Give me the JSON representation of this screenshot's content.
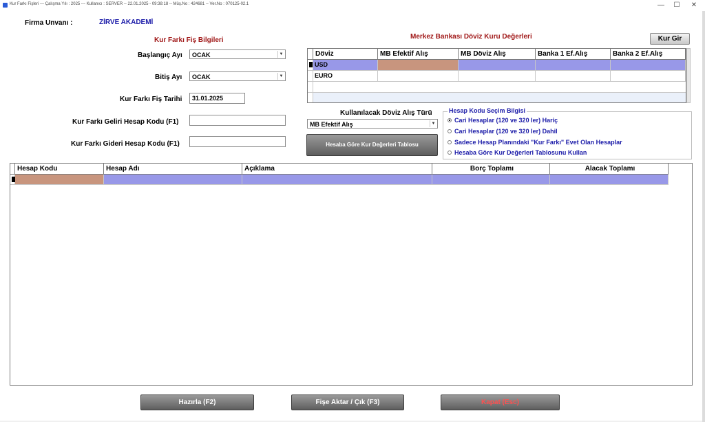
{
  "window": {
    "title": "Kur Farkı Fişleri  ---  Çalışma Yılı : 2025  ---  Kullanıcı : SERVER -- 22.01.2025 - 09:38:18  --  Müş.No : 424681 -- Ver.No : 070125-02.1",
    "minimize": "—",
    "maximize": "☐",
    "close": "✕"
  },
  "firma": {
    "label": "Firma Unvanı :",
    "value": "ZİRVE AKADEMİ"
  },
  "fis": {
    "section_title": "Kur Farkı Fiş Bilgileri",
    "baslangic_label": "Başlangıç Ayı",
    "baslangic_value": "OCAK",
    "bitis_label": "Bitiş Ayı",
    "bitis_value": "OCAK",
    "tarih_label": "Kur Farkı Fiş Tarihi",
    "tarih_value": "31.01.2025",
    "geliri_label": "Kur Farkı Geliri Hesap Kodu (F1)",
    "geliri_value": "",
    "gideri_label": "Kur Farkı Gideri Hesap Kodu (F1)",
    "gideri_value": ""
  },
  "doviz": {
    "section_title": "Merkez Bankası Döviz Kuru Değerleri",
    "kur_gir": "Kur Gir",
    "columns": [
      "Döviz",
      "MB Efektif Alış",
      "MB Döviz Alış",
      "Banka 1 Ef.Alış",
      "Banka 2 Ef.Alış"
    ],
    "rows": [
      [
        "USD",
        "",
        "",
        "",
        ""
      ],
      [
        "EURO",
        "",
        "",
        "",
        ""
      ]
    ],
    "alis_turu_label": "Kullanılacak Döviz Alış Türü",
    "alis_turu_value": "MB Efektif Alış",
    "tablo_button": "Hesaba Göre Kur Değerleri Tablosu"
  },
  "hesap_kodu": {
    "title": "Hesap Kodu Seçim Bilgisi",
    "options": [
      "Cari Hesaplar (120 ve 320 ler) Hariç",
      "Cari Hesaplar (120 ve 320 ler) Dahil",
      "Sadece Hesap Planındaki \"Kur Farkı\" Evet Olan Hesaplar",
      "Hesaba Göre Kur Değerleri Tablosunu Kullan"
    ],
    "selected_index": 0
  },
  "main_grid": {
    "columns": [
      "Hesap Kodu",
      "Hesap Adı",
      "Açıklama",
      "Borç Toplamı",
      "Alacak Toplamı"
    ]
  },
  "buttons": {
    "hazirla": "Hazırla (F2)",
    "aktar": "Fişe Aktar / Çık (F3)",
    "kapat": "Kapat (Esc)"
  }
}
